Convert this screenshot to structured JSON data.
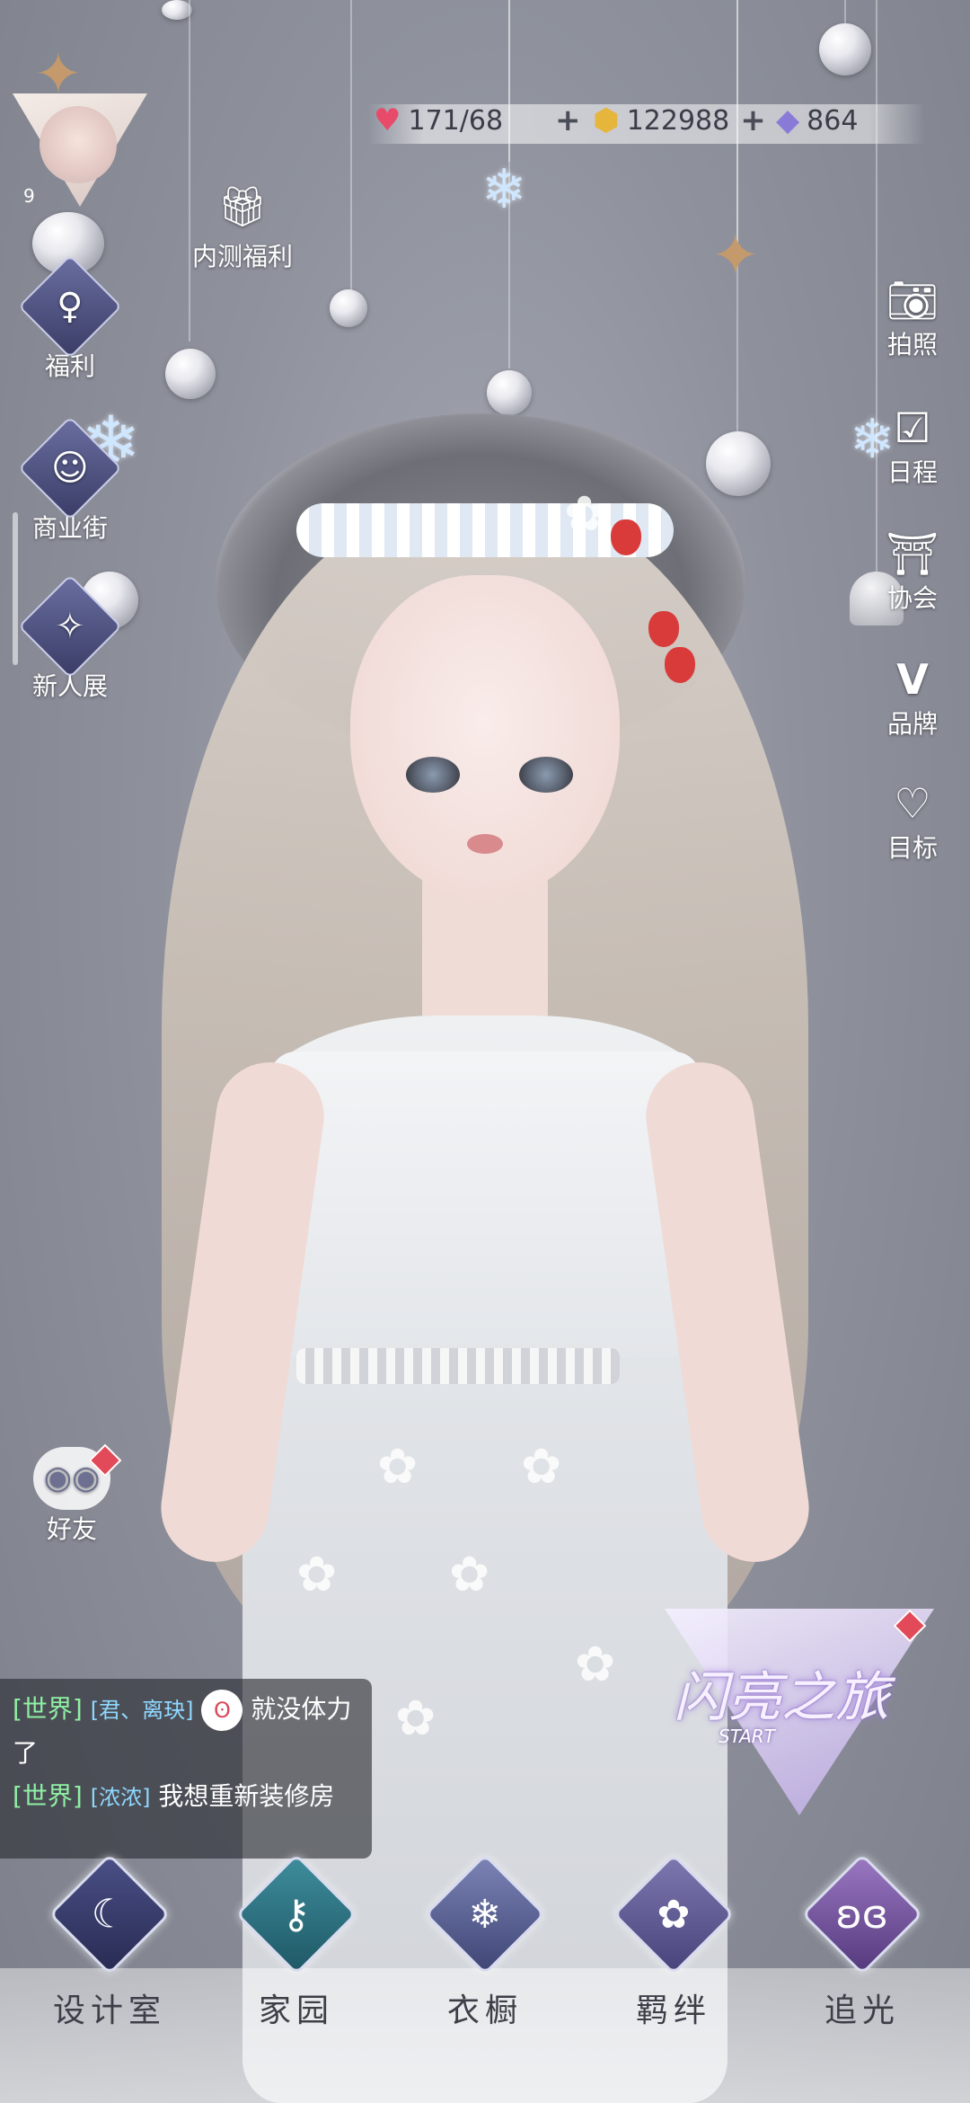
{
  "resources": {
    "stamina": "171/68",
    "coins": "122988",
    "diamonds": "864",
    "plus": "+"
  },
  "player": {
    "level": "9"
  },
  "left_menu": {
    "beta_welfare": "内测福利",
    "welfare": "福利",
    "shopping_street": "商业街",
    "newcomer_show": "新人展",
    "friends": "好友"
  },
  "right_menu": {
    "photo": "拍照",
    "schedule": "日程",
    "guild": "协会",
    "brand": "品牌",
    "goals": "目标"
  },
  "event": {
    "title": "闪亮之旅",
    "subtitle": "START"
  },
  "chat": [
    {
      "channel": "[世界]",
      "name": "[君、离玦]",
      "text": "就没体力了"
    },
    {
      "channel": "[世界]",
      "name": "[浓浓]",
      "text": "我想重新装修房"
    }
  ],
  "bottom_nav": {
    "design": "设计室",
    "home": "家园",
    "wardrobe": "衣橱",
    "bonds": "羁绊",
    "chase_light": "追光"
  },
  "colors": {
    "chat_channel": "#8ff0a4",
    "chat_name": "#8fd8ff",
    "badge_red": "#e24a5a"
  }
}
